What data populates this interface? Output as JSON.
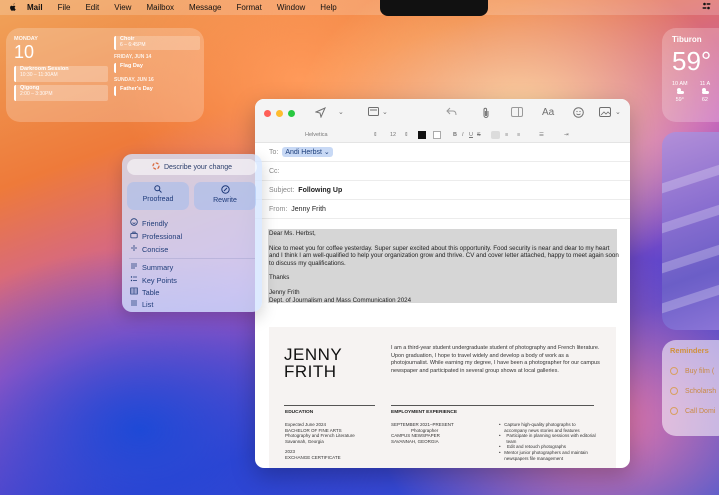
{
  "menubar": {
    "apple": "",
    "items": [
      "Mail",
      "File",
      "Edit",
      "View",
      "Mailbox",
      "Message",
      "Format",
      "Window",
      "Help"
    ]
  },
  "calendar": {
    "day_label": "MONDAY",
    "day_number": "10",
    "events_today": [
      {
        "title": "Darkroom Session",
        "time": "10:30 – 11:30AM"
      },
      {
        "title": "Qigong",
        "time": "2:00 – 3:30PM"
      }
    ],
    "right": {
      "top_event": {
        "title": "Choir",
        "time": "6 – 6:45PM"
      },
      "friday_header": "FRIDAY, JUN 14",
      "friday_event": "Flag Day",
      "sunday_header": "SUNDAY, JUN 16",
      "sunday_event": "Father's Day"
    }
  },
  "weather": {
    "city": "Tiburon",
    "temp": "59°",
    "hours": [
      {
        "time": "10 AM",
        "temp": "59°"
      },
      {
        "time": "11 A",
        "temp": "62"
      }
    ]
  },
  "reminders": {
    "title": "Reminders",
    "items": [
      "Buy film (",
      "Scholarsh",
      "Call Domi"
    ]
  },
  "mail": {
    "format": {
      "font": "Helvetica",
      "size": "12"
    },
    "to_label": "To:",
    "to_value": "Andi Herbst",
    "cc_label": "Cc:",
    "subject_label": "Subject:",
    "subject_value": "Following Up",
    "from_label": "From:",
    "from_value": "Jenny Frith",
    "body": {
      "greeting": "Dear Ms. Herbst,",
      "paragraph": "Nice to meet you for coffee yesterday. Super super excited about this opportunity. Food security is near and dear to my heart and I think I am well-qualified to help your organization grow and thrive. CV and cover letter attached, happy to meet again soon to discuss my qualifications.",
      "thanks": "Thanks",
      "sign_name": "Jenny Frith",
      "sign_dept": "Dept. of Journalism and Mass Communication 2024"
    },
    "resume": {
      "name_line1": "JENNY",
      "name_line2": "FRITH",
      "intro": "I am a third-year student undergraduate student of photography and French literature. Upon graduation, I hope to travel widely and develop a body of work as a photojournalist. While earning my degree, I have been a photographer for our campus newspaper and participated in several group shows at local galleries.",
      "education_title": "EDUCATION",
      "education_lines": [
        "Expected June 2024",
        "BACHELOR OF FINE ARTS",
        "Photography and French Literature",
        "Savannah, Georgia",
        "",
        "2023",
        "EXCHANGE CERTIFICATE"
      ],
      "employment_title": "EMPLOYMENT EXPERIENCE",
      "employment_lines": [
        "SEPTEMBER 2021–PRESENT",
        "Photographer",
        "CAMPUS NEWSPAPER",
        "SAVANNAH, GEORGIA"
      ],
      "bullets": [
        "Capture high-quality photographs to accompany news stories and features",
        "Participate in planning sessions with editorial team",
        "Edit and retouch photographs",
        "Mentor junior photographers and maintain newspapers file management"
      ]
    }
  },
  "writing_tools": {
    "describe": "Describe your change",
    "proofread": "Proofread",
    "rewrite": "Rewrite",
    "tone_items": [
      "Friendly",
      "Professional",
      "Concise"
    ],
    "format_items": [
      "Summary",
      "Key Points",
      "Table",
      "List"
    ]
  },
  "colors": {
    "accent": "#1e3a7a",
    "traffic_red": "#ff5f57",
    "traffic_yellow": "#febc2e",
    "traffic_green": "#28c840"
  }
}
